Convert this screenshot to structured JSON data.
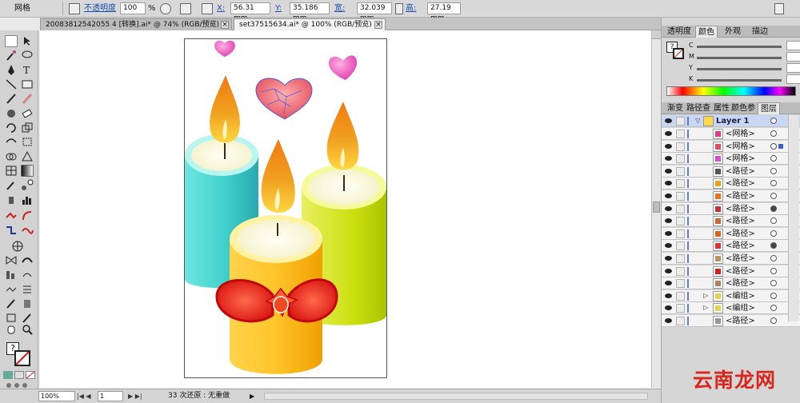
{
  "control_bar": {
    "selection_label": "网格",
    "opacity_label": "不透明度",
    "opacity_value": "100",
    "percent_sign": "%",
    "x_label": "X:",
    "x_value": "56.31 mm",
    "y_label": "Y:",
    "y_value": "35.186 mm",
    "width_label": "宽:",
    "width_value": "32.039 mm",
    "height_label": "高:",
    "height_value": "27.19 mm"
  },
  "doc_tabs": [
    {
      "label": "20083812542055 4 [转换].ai* @ 74% (RGB/预览)",
      "active": false
    },
    {
      "label": "set37515634.ai* @ 100% (RGB/预览)",
      "active": true
    }
  ],
  "status_bar": {
    "zoom": "100%",
    "page": "1",
    "history": "33 次还原 : 无重做"
  },
  "color_panel": {
    "tabs": [
      "透明度",
      "颜色",
      "外观",
      "描边"
    ],
    "active_tab": "颜色",
    "channels": [
      "C",
      "M",
      "Y",
      "K"
    ]
  },
  "layers_panel": {
    "tabs": [
      "渐变",
      "路径查",
      "属性",
      "颜色参",
      "图层"
    ],
    "active_tab": "图层",
    "layer_name": "Layer 1",
    "items": [
      {
        "name": "<网格>",
        "color": "#e23a8e",
        "target": "open"
      },
      {
        "name": "<网格>",
        "color": "#e24a60",
        "target": "selected"
      },
      {
        "name": "<网格>",
        "color": "#d84bd8",
        "target": "open"
      },
      {
        "name": "<路径>",
        "color": "#555555",
        "target": "open"
      },
      {
        "name": "<路径>",
        "color": "#f0a020",
        "target": "open"
      },
      {
        "name": "<路径>",
        "color": "#f07020",
        "target": "open"
      },
      {
        "name": "<路径>",
        "color": "#c83030",
        "target": "filled"
      },
      {
        "name": "<路径>",
        "color": "#cc6633",
        "target": "open"
      },
      {
        "name": "<路径>",
        "color": "#e06020",
        "target": "open"
      },
      {
        "name": "<路径>",
        "color": "#e03030",
        "target": "filled"
      },
      {
        "name": "<路径>",
        "color": "#c09060",
        "target": "open"
      },
      {
        "name": "<路径>",
        "color": "#d02020",
        "target": "open"
      },
      {
        "name": "<路径>",
        "color": "#b08060",
        "target": "open"
      },
      {
        "name": "<编组>",
        "color": "#e8d050",
        "target": "open"
      },
      {
        "name": "<编组>",
        "color": "#e8d050",
        "target": "open"
      },
      {
        "name": "<路径>",
        "color": "#999999",
        "target": "open"
      }
    ]
  },
  "watermark": "云南龙网"
}
